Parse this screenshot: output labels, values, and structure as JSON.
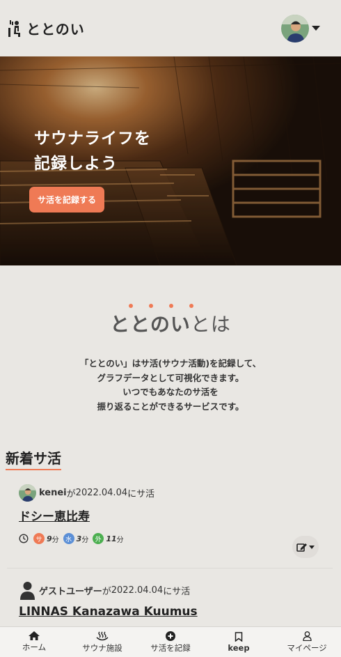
{
  "header": {
    "logo_text": "ととのい",
    "logo_icon": "sauna-person-icon",
    "avatar_alt": "user-avatar"
  },
  "hero": {
    "title_line1": "サウナライフを",
    "title_line2": "記録しよう",
    "cta_label": "サ活を記録する"
  },
  "about": {
    "heading_strong": "ととのい",
    "heading_rest": "とは",
    "desc_line1": "「ととのい」はサ活(サウナ活動)を記録して、",
    "desc_line2": "グラフデータとして可視化できます。",
    "desc_line3": "いつでもあなたのサ活を",
    "desc_line4": "振り返ることができるサービスです。"
  },
  "recent": {
    "title": "新着サ活",
    "posts": [
      {
        "author": "kenei",
        "ga": "が",
        "date": "2022.04.04",
        "suffix": "にサ活",
        "facility": "ドシー恵比寿",
        "stats": {
          "sauna_label": "サ",
          "sauna_val": "9",
          "sauna_unit": "分",
          "water_label": "水",
          "water_val": "3",
          "water_unit": "分",
          "outside_label": "外",
          "outside_val": "11",
          "outside_unit": "分"
        }
      },
      {
        "author": "ゲストユーザー",
        "ga": "が",
        "date": "2022.04.04",
        "suffix": "にサ活",
        "facility": "LINNAS Kanazawa Kuumus"
      }
    ]
  },
  "colors": {
    "accent": "#ef7a55",
    "sauna": "#ef7a55",
    "water": "#5b8fd6",
    "outside": "#4caf50"
  },
  "nav": [
    {
      "label": "ホーム",
      "icon": "home-icon"
    },
    {
      "label": "サウナ施設",
      "icon": "hot-spring-icon"
    },
    {
      "label": "サ活を記録",
      "icon": "plus-circle-icon"
    },
    {
      "label": "keep",
      "icon": "bookmark-icon"
    },
    {
      "label": "マイページ",
      "icon": "user-icon"
    }
  ]
}
